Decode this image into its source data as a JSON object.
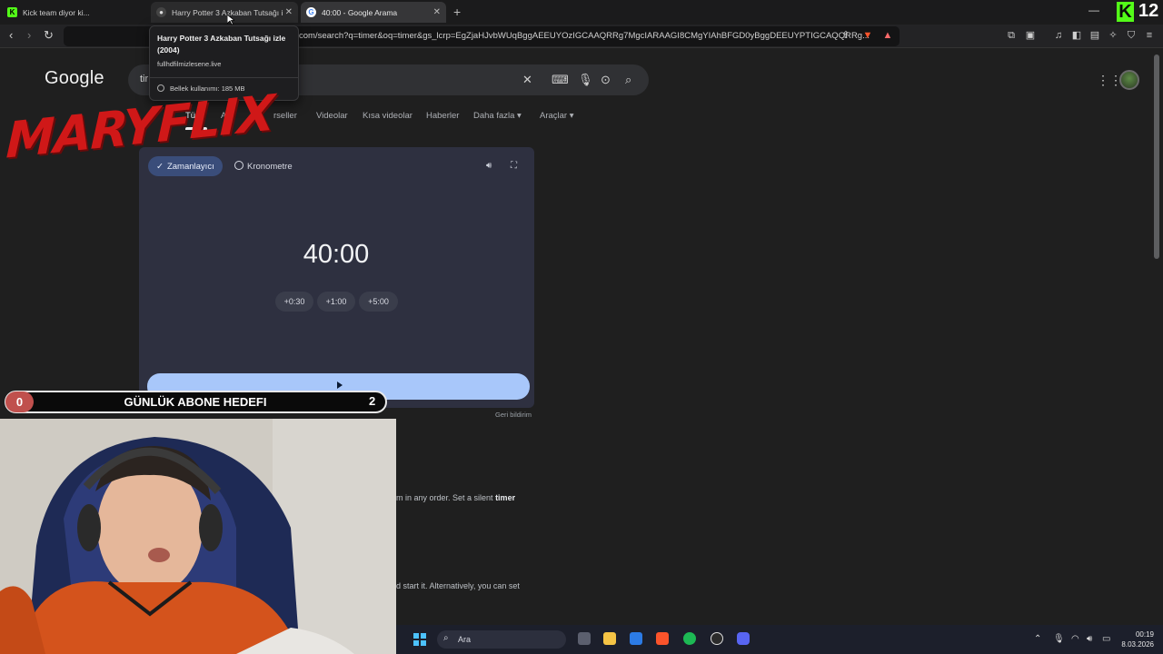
{
  "browser": {
    "tabs": [
      {
        "title": "Kick team diyor ki..."
      },
      {
        "title": "Harry Potter 3 Azkaban Tutsağı i"
      },
      {
        "title": "40:00 - Google Arama"
      }
    ],
    "new_tab": "+",
    "url": "com/search?q=timer&oq=timer&gs_lcrp=EgZjaHJvbWUqBggAEEUYOzIGCAAQRRg7MgcIARAAGI8CMgYIAhBFGD0yBggDEEUYPTIGCAQQRRg...",
    "kick_count": "12"
  },
  "tooltip": {
    "title": "Harry Potter 3 Azkaban Tutsağı izle (2004)",
    "host": "fullhdfilmizlesene.live",
    "memory": "Bellek kullanımı: 185 MB"
  },
  "google": {
    "logo": "Google",
    "query": "tir",
    "tabs": [
      "Tüm",
      "Al",
      "rseller",
      "Videolar",
      "Kısa videolar",
      "Haberler",
      "Daha fazla",
      "Araçlar"
    ]
  },
  "timer": {
    "mode_timer": "Zamanlayıcı",
    "mode_stopwatch": "Kronometre",
    "time": "40:00",
    "add_buttons": [
      "+0:30",
      "+1:00",
      "+5:00"
    ],
    "feedback": "Geri bildirim"
  },
  "snippets": {
    "line1_pre": "m in any order. Set a silent ",
    "line1_bold": "timer",
    "line2": "d start it. Alternatively, you can set"
  },
  "overlay": {
    "brand": "MARYFLIX",
    "goal_current": "0",
    "goal_label": "GÜNLÜK ABONE HEDEFI",
    "goal_target": "2"
  },
  "taskbar": {
    "search": "Ara",
    "time": "00:19",
    "date": "8.03.2026"
  },
  "colors": {
    "accent_blue": "#a8c7fa",
    "brand_red": "#d01818",
    "kick_green": "#53fc18"
  }
}
